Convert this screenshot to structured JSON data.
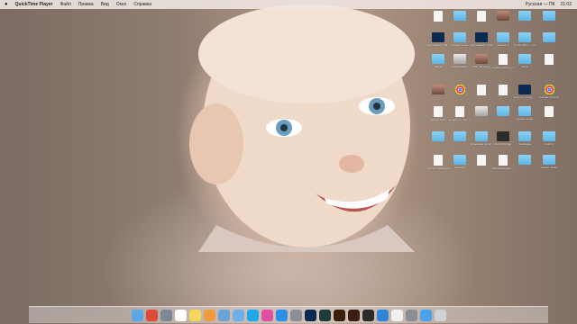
{
  "menubar": {
    "apple": "",
    "app_name": "QuickTime Player",
    "items": [
      "Файл",
      "Правка",
      "Вид",
      "Окно",
      "Справка"
    ],
    "clock": "21:02",
    "input_lang": "Русская — ПК"
  },
  "desktop": {
    "items": [
      {
        "label": "",
        "kind": "doc"
      },
      {
        "label": "",
        "kind": "folder"
      },
      {
        "label": "",
        "kind": "doc"
      },
      {
        "label": "",
        "kind": "img"
      },
      {
        "label": "",
        "kind": "folder"
      },
      {
        "label": "",
        "kind": "folder"
      },
      {
        "label": "сертификат-сайт.psd",
        "kind": "psd"
      },
      {
        "label": "Новая папка",
        "kind": "folder"
      },
      {
        "label": "сертификат-палата-3.psd",
        "kind": "psd"
      },
      {
        "label": "мебель 2",
        "kind": "folder"
      },
      {
        "label": "27.01.2016 — спор...франч",
        "kind": "folder"
      },
      {
        "label": "",
        "kind": "folder"
      },
      {
        "label": "Skype",
        "kind": "folder"
      },
      {
        "label": "ЗАКАЗЧИКИ",
        "kind": "drive"
      },
      {
        "label": "IMG_6079.jpg",
        "kind": "img"
      },
      {
        "label": "Logika_kontrol_proudf_fun9",
        "kind": "doc"
      },
      {
        "label": "2016",
        "kind": "folder"
      },
      {
        "label": "",
        "kind": "doc"
      },
      {
        "label": "",
        "kind": "img"
      },
      {
        "label": "",
        "kind": "chrome"
      },
      {
        "label": "",
        "kind": "doc"
      },
      {
        "label": "",
        "kind": "doc"
      },
      {
        "label": "Logo_в_стиле_...a.psd",
        "kind": "psd"
      },
      {
        "label": "Google Chrome",
        "kind": "chrome"
      },
      {
        "label": "Новый текст",
        "kind": "doc"
      },
      {
        "label": "морда_по_107 _lc.jpg",
        "kind": "doc"
      },
      {
        "label": "",
        "kind": "drive"
      },
      {
        "label": "",
        "kind": "folder"
      },
      {
        "label": "Новая папка",
        "kind": "folder"
      },
      {
        "label": "",
        "kind": "doc"
      },
      {
        "label": "",
        "kind": "folder"
      },
      {
        "label": "",
        "kind": "folder"
      },
      {
        "label": "Основные кописпл",
        "kind": "folder"
      },
      {
        "label": "Фото4700.jpg",
        "kind": "dark"
      },
      {
        "label": "Ломбарды",
        "kind": "folder"
      },
      {
        "label": "Кейс 2",
        "kind": "folder"
      },
      {
        "label": "QuickTimePlayerF.4....5.dmg",
        "kind": "doc"
      },
      {
        "label": "фильмы",
        "kind": "folder"
      },
      {
        "label": "",
        "kind": "doc"
      },
      {
        "label": "WindowsDigital...tar.gz",
        "kind": "doc"
      },
      {
        "label": "",
        "kind": "folder"
      },
      {
        "label": "Новая папка",
        "kind": "folder"
      }
    ]
  },
  "dock": {
    "apps": [
      "finder-icon",
      "chrome-icon",
      "launchpad-icon",
      "calendar-icon",
      "notes-icon",
      "photos-icon",
      "preview-icon",
      "mail-icon",
      "skype-icon",
      "itunes-icon",
      "appstore-icon",
      "system-prefs-icon",
      "photoshop-icon",
      "lightroom-icon",
      "illustrator-icon",
      "bridge-icon",
      "finalcut-icon",
      "quicktime-icon",
      "textedit-icon",
      "utilities-icon",
      "downloads-icon",
      "trash-icon"
    ]
  }
}
